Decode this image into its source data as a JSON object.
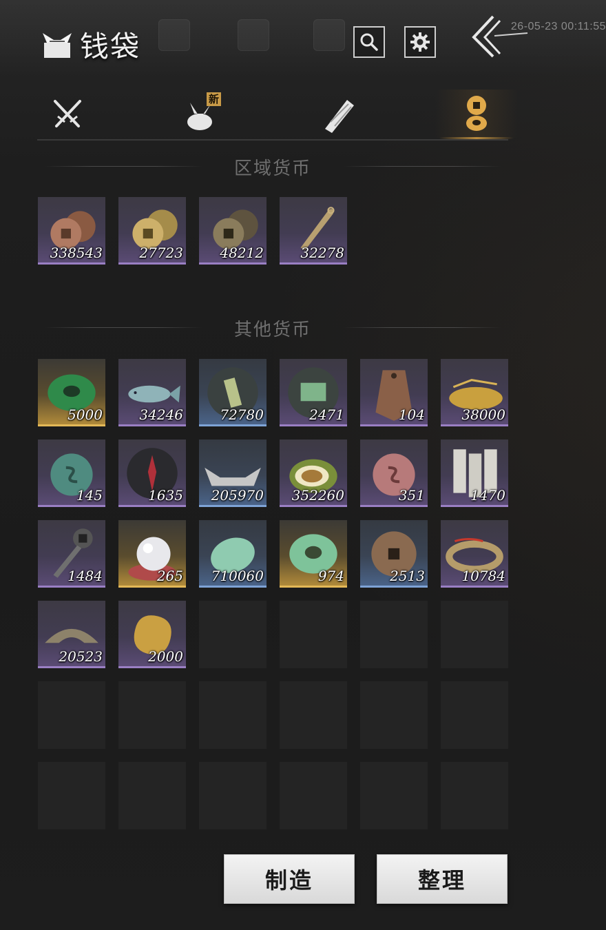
{
  "header": {
    "title": "钱袋",
    "timestamp": "26-05-23 00:11:55",
    "buttons": {
      "search_icon": "search-icon",
      "settings_icon": "gear-icon",
      "back_icon": "double-chevron-left-icon"
    }
  },
  "tabs": [
    {
      "icon": "crossed-swords-icon",
      "active": false,
      "badge": ""
    },
    {
      "icon": "cloth-bundle-icon",
      "active": false,
      "badge": "新"
    },
    {
      "icon": "scroll-icon",
      "active": false,
      "badge": ""
    },
    {
      "icon": "coins-icon",
      "active": true,
      "badge": ""
    }
  ],
  "sections": {
    "regional": {
      "title": "区域货币",
      "items": [
        {
          "icon": "copper-coins-icon",
          "count": "338543",
          "rarity": "purple"
        },
        {
          "icon": "gold-coins-icon",
          "count": "27723",
          "rarity": "purple"
        },
        {
          "icon": "bronze-coins-icon",
          "count": "48212",
          "rarity": "purple"
        },
        {
          "icon": "knife-coin-icon",
          "count": "32278",
          "rarity": "purple"
        }
      ]
    },
    "other": {
      "title": "其他货币",
      "items": [
        {
          "icon": "green-jade-disc-icon",
          "count": "5000",
          "rarity": "gold"
        },
        {
          "icon": "fish-icon",
          "count": "34246",
          "rarity": "purple"
        },
        {
          "icon": "jade-token-icon",
          "count": "72780",
          "rarity": "blue"
        },
        {
          "icon": "map-token-icon",
          "count": "2471",
          "rarity": "purple"
        },
        {
          "icon": "bronze-tablet-icon",
          "count": "104",
          "rarity": "purple"
        },
        {
          "icon": "grain-pile-icon",
          "count": "38000",
          "rarity": "purple"
        },
        {
          "icon": "teal-stone-coin-icon",
          "count": "145",
          "rarity": "purple"
        },
        {
          "icon": "red-sigil-icon",
          "count": "1635",
          "rarity": "purple"
        },
        {
          "icon": "silver-ingot-icon",
          "count": "205970",
          "rarity": "blue"
        },
        {
          "icon": "melon-icon",
          "count": "352260",
          "rarity": "purple"
        },
        {
          "icon": "pink-stone-coin-icon",
          "count": "351",
          "rarity": "purple"
        },
        {
          "icon": "paper-slips-icon",
          "count": "1470",
          "rarity": "purple"
        },
        {
          "icon": "key-coin-icon",
          "count": "1484",
          "rarity": "purple"
        },
        {
          "icon": "pearl-icon",
          "count": "265",
          "rarity": "gold"
        },
        {
          "icon": "jade-stone-icon",
          "count": "710060",
          "rarity": "blue"
        },
        {
          "icon": "jade-ring-icon",
          "count": "974",
          "rarity": "gold"
        },
        {
          "icon": "square-hole-coin-icon",
          "count": "2513",
          "rarity": "blue"
        },
        {
          "icon": "coin-string-icon",
          "count": "10784",
          "rarity": "purple"
        },
        {
          "icon": "half-coin-icon",
          "count": "20523",
          "rarity": "purple"
        },
        {
          "icon": "gold-nugget-icon",
          "count": "2000",
          "rarity": "purple"
        }
      ],
      "empty_slots": 16
    }
  },
  "actions": {
    "craft": "制造",
    "sort": "整理"
  },
  "colors": {
    "purple_rarity": "#9a7fc4",
    "blue_rarity": "#7ea3d6",
    "gold_rarity": "#e3b857",
    "tab_active": "#b98b3e"
  }
}
